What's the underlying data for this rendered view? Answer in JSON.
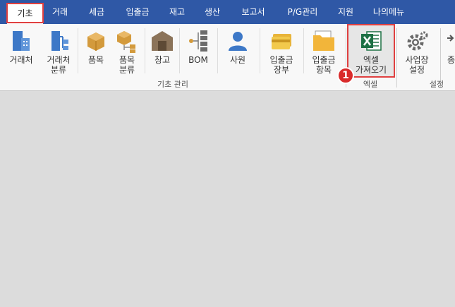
{
  "tabs": [
    {
      "label": "기초"
    },
    {
      "label": "거래"
    },
    {
      "label": "세금"
    },
    {
      "label": "입출금"
    },
    {
      "label": "재고"
    },
    {
      "label": "생산"
    },
    {
      "label": "보고서"
    },
    {
      "label": "P/G관리"
    },
    {
      "label": "지원"
    },
    {
      "label": "나의메뉴"
    }
  ],
  "ribbon": {
    "buttons": [
      {
        "line1": "거래처",
        "line2": "",
        "icon": "client-icon"
      },
      {
        "line1": "거래처",
        "line2": "분류",
        "icon": "client-category-icon"
      },
      {
        "line1": "품목",
        "line2": "",
        "icon": "item-icon"
      },
      {
        "line1": "품목",
        "line2": "분류",
        "icon": "item-category-icon"
      },
      {
        "line1": "창고",
        "line2": "",
        "icon": "warehouse-icon"
      },
      {
        "line1": "BOM",
        "line2": "",
        "icon": "bom-icon"
      },
      {
        "line1": "사원",
        "line2": "",
        "icon": "employee-icon"
      },
      {
        "line1": "입출금",
        "line2": "장부",
        "icon": "ledger-icon"
      },
      {
        "line1": "입출금",
        "line2": "항목",
        "icon": "folder-icon"
      },
      {
        "line1": "엑셀",
        "line2": "가져오기",
        "icon": "excel-icon"
      },
      {
        "line1": "사업장",
        "line2": "설정",
        "icon": "gear-icon"
      },
      {
        "line1": "종",
        "line2": "",
        "icon": "exit-icon"
      }
    ],
    "groups": {
      "basic": "기초 관리",
      "excel": "엑셀",
      "settings": "설정"
    }
  },
  "annotation": {
    "badge": "1"
  },
  "colors": {
    "tab_bar": "#2f58a6",
    "highlight": "#e04040",
    "badge": "#d92b2b",
    "excel_green": "#1d7044"
  }
}
